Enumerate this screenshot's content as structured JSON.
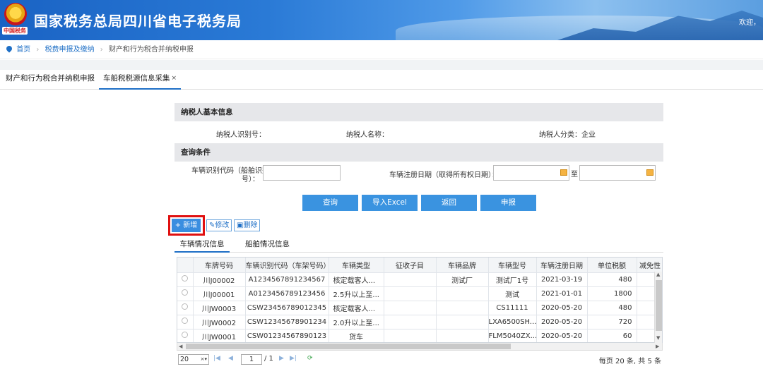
{
  "header": {
    "site_title": "国家税务总局四川省电子税务局",
    "logo_text": "中国税务",
    "welcome": "欢迎，"
  },
  "breadcrumb": {
    "home": "首页",
    "level1": "税费申报及缴纳",
    "current": "财产和行为税合并纳税申报"
  },
  "page_tabs": {
    "tab1": "财产和行为税合并纳税申报",
    "tab2": "车船税税源信息采集",
    "close": "×"
  },
  "taxpayer": {
    "section_title": "纳税人基本信息",
    "id_label": "纳税人识别号：",
    "name_label": "纳税人名称：",
    "category_label": "纳税人分类：企业"
  },
  "query": {
    "section_title": "查询条件",
    "vin_label_line1": "车辆识别代码（船舶识别",
    "vin_label_line2": "号）：",
    "vin_value": "",
    "date_label": "车辆注册日期（取得所有权日期）：",
    "date_from": "",
    "date_to_label": "至",
    "date_to": ""
  },
  "actions": {
    "query": "查询",
    "import": "导入Excel",
    "back": "返回",
    "declare": "申报"
  },
  "toolbar": {
    "add": "+ 新增",
    "edit": "修改",
    "delete": "删除"
  },
  "sub_tabs": {
    "vehicles": "车辆情况信息",
    "ships": "船舶情况信息"
  },
  "grid": {
    "columns": [
      "车牌号码",
      "车辆识别代码（车架号码）",
      "车辆类型",
      "征收子目",
      "车辆品牌",
      "车辆型号",
      "车辆注册日期",
      "单位税额",
      "减免性"
    ],
    "rows": [
      [
        "川J00002",
        "A1234567891234567",
        "核定载客人...",
        "",
        "测试厂",
        "测试厂1号",
        "2021-03-19",
        "480"
      ],
      [
        "川J00001",
        "A0123456789123456",
        "2.5升以上至...",
        "",
        "",
        "测试",
        "2021-01-01",
        "1800"
      ],
      [
        "川JW0003",
        "CSW23456789012345",
        "核定载客人...",
        "",
        "",
        "CS11111",
        "2020-05-20",
        "480"
      ],
      [
        "川JW0002",
        "CSW12345678901234",
        "2.0升以上至...",
        "",
        "",
        "LXA6500SH...",
        "2020-05-20",
        "720"
      ],
      [
        "川JW0001",
        "CSW01234567890123",
        "货车",
        "",
        "",
        "FLM5040ZX...",
        "2020-05-20",
        "60"
      ]
    ]
  },
  "pager": {
    "page_size": "20",
    "page": "1",
    "total_pages": "/ 1",
    "info": "每页 20 条, 共 5 条"
  }
}
